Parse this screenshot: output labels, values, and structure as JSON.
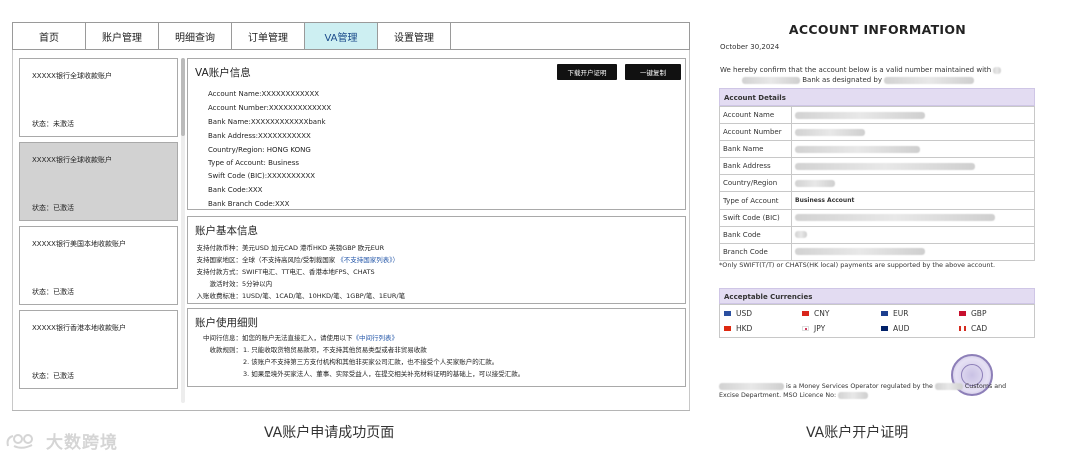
{
  "nav": {
    "tabs": [
      "首页",
      "账户管理",
      "明细查询",
      "订单管理",
      "VA管理",
      "设置管理"
    ],
    "active": 4
  },
  "sidebar": {
    "accounts": [
      {
        "name": "XXXXX银行全球收款账户",
        "status": "状态：未激活"
      },
      {
        "name": "XXXXX银行全球收款账户",
        "status": "状态：已激活"
      },
      {
        "name": "XXXXX银行美国本地收款账户",
        "status": "状态：已激活"
      },
      {
        "name": "XXXXX银行香港本地收款账户",
        "status": "状态：已激活"
      }
    ]
  },
  "va_info": {
    "title": "VA账户信息",
    "download_button": "下载开户证明",
    "copy_button": "一键复制",
    "fields": [
      "Account Name:XXXXXXXXXXXX",
      "Account Number:XXXXXXXXXXXXX",
      "Bank Name:XXXXXXXXXXXXbank",
      "Bank Address:XXXXXXXXXXX",
      "Country/Region: HONG KONG",
      "Type of Account: Business",
      "Swift Code (BIC):XXXXXXXXXX",
      "Bank Code:XXX",
      "Bank Branch Code:XXX"
    ]
  },
  "basic_info": {
    "title": "账户基本信息",
    "rows": [
      {
        "label": "支持付款币种：",
        "value": "美元USD 加元CAD 港币HKD 英镑GBP 欧元EUR",
        "link": ""
      },
      {
        "label": "支持国家地区：",
        "value": "全球（不支持高风险/受制裁国家",
        "link": "《不支持国家列表》）"
      },
      {
        "label": "支持付款方式：",
        "value": "SWIFT电汇、TT电汇、香港本地FPS、CHATS",
        "link": ""
      },
      {
        "label": "激活时效：",
        "value": "5分钟以内",
        "link": ""
      },
      {
        "label": "入账收费标准：",
        "value": "1USD/笔、1CAD/笔、10HKD/笔、1GBP/笔、1EUR/笔",
        "link": ""
      }
    ]
  },
  "usage_rules": {
    "title": "账户使用细则",
    "intro_label": "中间行信息：",
    "intro_text": "如您的账户无法直接汇入，请使用以下",
    "intro_link": "《中间行列表》",
    "rules_label": "收款规则：",
    "rules": [
      "1. 只能收取货物贸易款项，不支持其他贸易类型或者非贸易收款",
      "2. 该账户不支持第三方支付机构和其他非买家公司汇款，也不接受个人买家账户的汇款。",
      "3. 如果是境外买家法人、董事、实际受益人，在提交相关补充材料证明的基础上，可以接受汇款。"
    ]
  },
  "captions": {
    "left": "VA账户申请成功页面",
    "right": "VA账户开户证明"
  },
  "watermark": "大数跨境",
  "certificate": {
    "title": "ACCOUNT INFORMATION",
    "date": "October 30,2024",
    "intro_1": "We  hereby  confirm  that  the  account  below  is  a  valid  number  maintained  with",
    "intro_2": "Bank  as designated by",
    "details_head": "Account Details",
    "details": [
      {
        "label": "Account Name",
        "value": ""
      },
      {
        "label": "Account Number",
        "value": ""
      },
      {
        "label": "Bank Name",
        "value": ""
      },
      {
        "label": "Bank Address",
        "value": ""
      },
      {
        "label": "Country/Region",
        "value": ""
      },
      {
        "label": "Type of Account",
        "value": "Business Account"
      },
      {
        "label": "Swift Code (BIC)",
        "value": ""
      },
      {
        "label": "Bank Code",
        "value": ""
      },
      {
        "label": "Branch Code",
        "value": ""
      }
    ],
    "note": "*Only SWIFT(T/T) or CHATS(HK local) payments are supported by the above account.",
    "currencies_head": "Acceptable Currencies",
    "currencies": [
      {
        "code": "USD",
        "color": "#2a4fa0"
      },
      {
        "code": "CNY",
        "color": "#d9261c"
      },
      {
        "code": "EUR",
        "color": "#1d3f8f"
      },
      {
        "code": "GBP",
        "color": "#c8102e"
      },
      {
        "code": "HKD",
        "color": "#de2910"
      },
      {
        "code": "JPY",
        "color": "#bc002d"
      },
      {
        "code": "AUD",
        "color": "#012169"
      },
      {
        "code": "CAD",
        "color": "#d52b1e"
      }
    ],
    "footer_1": "is  a  Money  Services  Operator  regulated  by  the",
    "footer_2": "Customs  and",
    "footer_3": "Excise Department. MSO Licence No:"
  }
}
